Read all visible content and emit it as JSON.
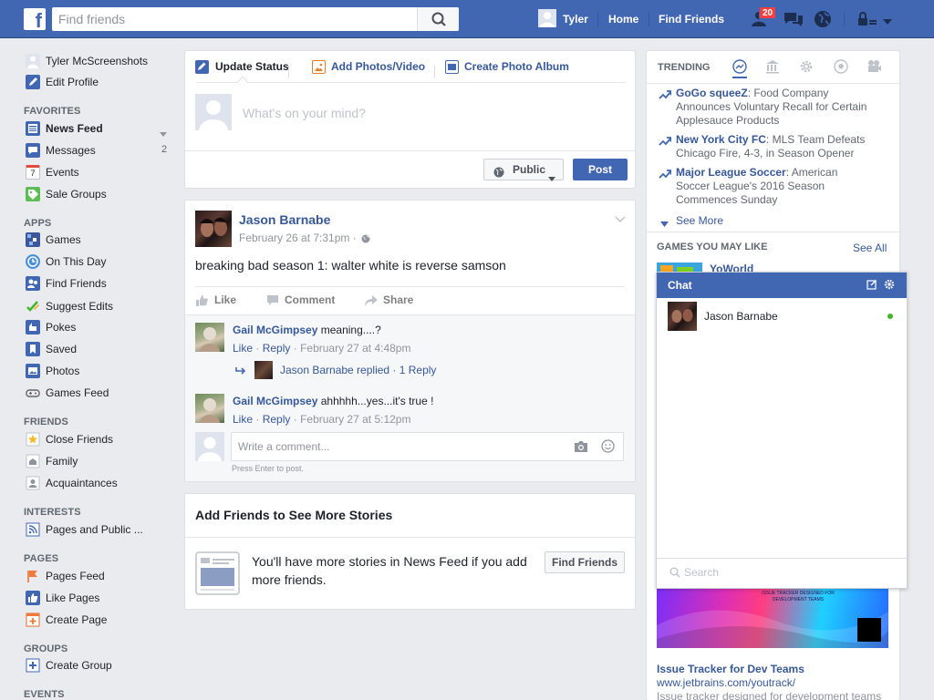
{
  "topbar": {
    "logo": "f",
    "search_placeholder": "Find friends",
    "user_name": "Tyler",
    "home": "Home",
    "find_friends": "Find Friends",
    "friend_requests_count": "20"
  },
  "sidebar": {
    "profile_name": "Tyler McScreenshots",
    "edit_profile": "Edit Profile",
    "favorites_header": "FAVORITES",
    "favorites": [
      "News Feed",
      "Messages",
      "Events",
      "Sale Groups"
    ],
    "messages_count": "2",
    "events_icon_text": "7",
    "apps_header": "APPS",
    "apps": [
      "Games",
      "On This Day",
      "Find Friends",
      "Suggest Edits",
      "Pokes",
      "Saved",
      "Photos",
      "Games Feed"
    ],
    "friends_header": "FRIENDS",
    "friends": [
      "Close Friends",
      "Family",
      "Acquaintances"
    ],
    "interests_header": "INTERESTS",
    "interests": [
      "Pages and Public ..."
    ],
    "pages_header": "PAGES",
    "pages": [
      "Pages Feed",
      "Like Pages",
      "Create Page"
    ],
    "groups_header": "GROUPS",
    "groups": [
      "Create Group"
    ],
    "events_header": "EVENTS"
  },
  "composer": {
    "tab_update": "Update Status",
    "tab_photos": "Add Photos/Video",
    "tab_album": "Create Photo Album",
    "placeholder": "What's on your mind?",
    "privacy": "Public",
    "post_button": "Post"
  },
  "post": {
    "author": "Jason Barnabe",
    "timestamp": "February 26 at 7:31pm",
    "separator": "·",
    "text": "breaking bad season 1: walter white is reverse samson",
    "actions": {
      "like": "Like",
      "comment": "Comment",
      "share": "Share"
    },
    "comments": [
      {
        "author": "Gail McGimpsey",
        "text": "meaning....?",
        "like": "Like",
        "reply": "Reply",
        "time": "February 27 at 4:48pm"
      },
      {
        "author": "Gail McGimpsey",
        "text": "ahhhhh...yes...it's true !",
        "like": "Like",
        "reply": "Reply",
        "time": "February 27 at 5:12pm"
      }
    ],
    "dot": "·",
    "reply_summary": "Jason Barnabe replied · 1 Reply",
    "write_placeholder": "Write a comment...",
    "press_enter": "Press Enter to post."
  },
  "add_friends": {
    "title": "Add Friends to See More Stories",
    "body": "You'll have more stories in News Feed if you add more friends.",
    "button": "Find Friends"
  },
  "trending": {
    "header": "TRENDING",
    "items": [
      {
        "topic": "GoGo squeeZ",
        "desc": ": Food Company Announces Voluntary Recall for Certain Applesauce Products"
      },
      {
        "topic": "New York City FC",
        "desc": ": MLS Team Defeats Chicago Fire, 4-3, in Season Opener"
      },
      {
        "topic": "Major League Soccer",
        "desc": ": American Soccer League's 2016 Season Commences Sunday"
      }
    ],
    "see_more": "See More"
  },
  "games": {
    "header": "GAMES YOU MAY LIKE",
    "see_all": "See All",
    "first_game": "YoWorld"
  },
  "chat": {
    "title": "Chat",
    "friend": "Jason Barnabe",
    "search_placeholder": "Search"
  },
  "ad": {
    "banner_text": "ISSUE TRACKER DESIGNED FOR DEVELOPMENT TEAMS",
    "title": "Issue Tracker for Dev Teams",
    "url": "www.jetbrains.com/youtrack/",
    "desc": "Issue tracker designed for development teams"
  },
  "colors": {
    "brand": "#4267b2",
    "link": "#365899",
    "online": "#42b72a",
    "badge": "#fa3e3e"
  }
}
